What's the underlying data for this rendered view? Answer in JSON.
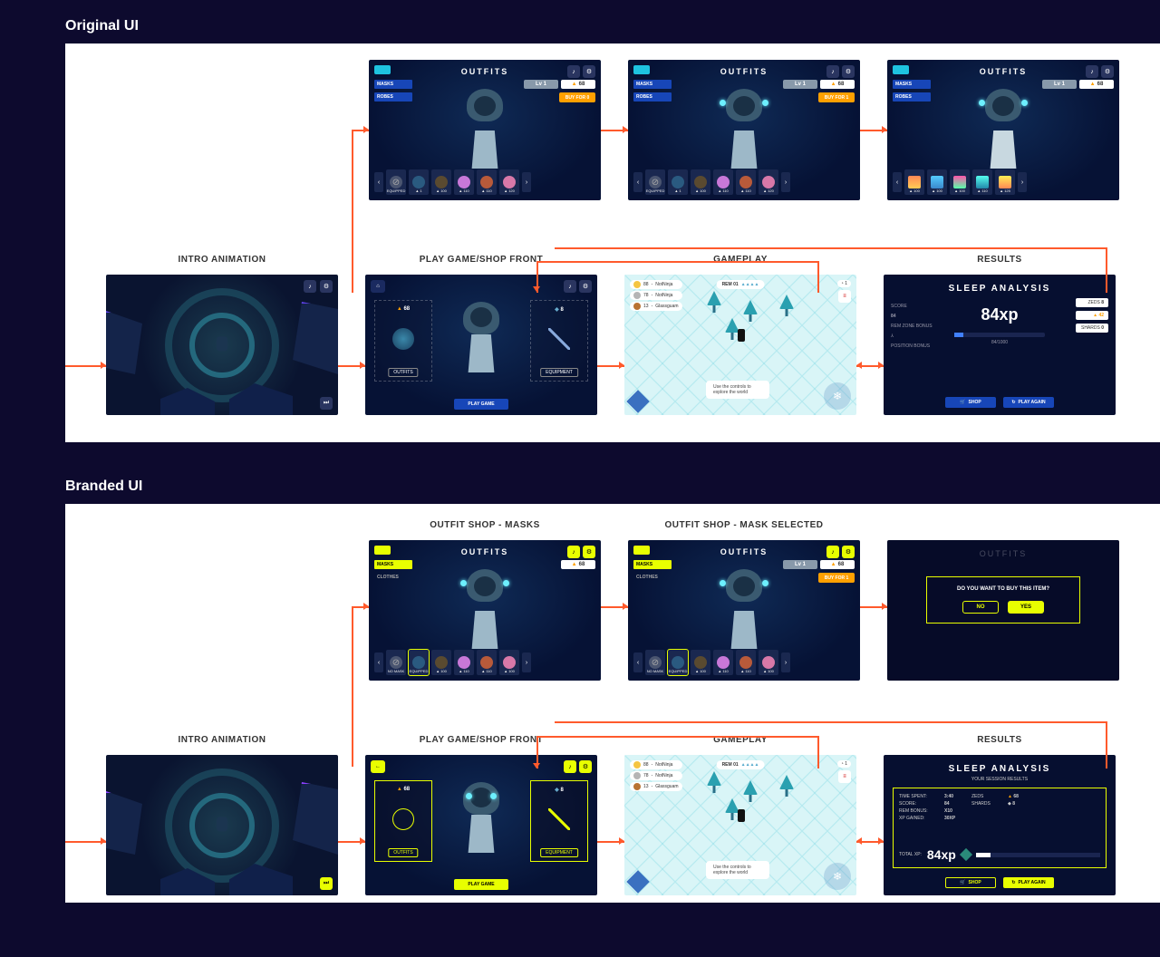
{
  "sections": {
    "original": {
      "title": "Original UI"
    },
    "branded": {
      "title": "Branded UI"
    }
  },
  "stage_labels": {
    "intro": "INTRO ANIMATION",
    "shopfront": "PLAY GAME/SHOP FRONT",
    "gameplay": "GAMEPLAY",
    "results": "RESULTS",
    "shop_masks": "OUTFIT SHOP - MASKS",
    "shop_mask_selected": "OUTFIT SHOP - MASK SELECTED"
  },
  "colors": {
    "accent_original": "#1746b8",
    "accent_branded": "#e8ff00",
    "flow": "#ff5a2c",
    "bg_page": "#0d0a2e"
  },
  "outfits_screen": {
    "title": "OUTFITS",
    "back_icon": "arrow-left",
    "top_buttons": [
      "sound-icon",
      "settings-icon"
    ],
    "tabs_original": [
      "MASKS",
      "ROBES"
    ],
    "tabs_branded": [
      "MASKS",
      "CLOTHES"
    ],
    "currency_chip": {
      "icon": "triangle",
      "value": 68
    },
    "level_chip": "Lv 1",
    "buy_button": "BUY FOR 1",
    "buy_button_none": "BUY FOR 0",
    "no_mask_label": "NO MASK",
    "equipped_label": "EQUIPPED",
    "mask_prices": [
      1,
      100,
      110,
      110,
      120
    ],
    "mask_prices_branded": [
      1,
      100,
      110,
      110,
      100
    ],
    "robe_prices": [
      100,
      100,
      100,
      110,
      125
    ]
  },
  "shopfront_screen": {
    "home_icon": "home",
    "top_buttons": [
      "sound-icon",
      "settings-icon"
    ],
    "left_panel": {
      "currency_icon": "triangle",
      "currency_value": 68,
      "label": "OUTFITS"
    },
    "right_panel": {
      "currency_icon": "diamond",
      "currency_value": 8,
      "label": "EQUIPMENT"
    },
    "play_button": "PLAY GAME"
  },
  "gameplay_screen": {
    "leaderboard": [
      {
        "rank": 88,
        "name": "NotNinja",
        "medal": "#f5c542"
      },
      {
        "rank": 78,
        "name": "NotNinja",
        "medal": "#b5b5b5"
      },
      {
        "rank": 13,
        "name": "Glassguam",
        "medal": "#b87333"
      }
    ],
    "rem_label": "REM 01",
    "rem_icons": 4,
    "tip": "Use the controls to explore the world",
    "ctrl_icon": "snowflake",
    "menu_icon": "menu"
  },
  "results_screen_original": {
    "title": "SLEEP ANALYSIS",
    "xp": "84xp",
    "progress_label": "84/1000",
    "left_stats": [
      {
        "label": "SCORE",
        "value": "84"
      },
      {
        "label": "REM ZONE BONUS",
        "value": ""
      },
      {
        "label": "POSITION BONUS",
        "value": ""
      }
    ],
    "right_stats": [
      {
        "label": "ZEDS",
        "value": 8
      },
      {
        "label": "",
        "value": 42
      },
      {
        "label": "SHARDS",
        "value": 0
      }
    ],
    "shop_button": "SHOP",
    "again_button": "PLAY AGAIN"
  },
  "results_screen_branded": {
    "title": "SLEEP ANALYSIS",
    "subtitle": "YOUR SESSION RESULTS",
    "rows_left": [
      {
        "label": "TIME SPENT:",
        "value": "3:40"
      },
      {
        "label": "SCORE:",
        "value": "84"
      },
      {
        "label": "REM BONUS:",
        "value": "X10"
      },
      {
        "label": "XP GAINED:",
        "value": "30XP"
      }
    ],
    "rows_right": [
      {
        "label": "ZEDS",
        "value": 68
      },
      {
        "label": "SHARDS",
        "value": 8
      }
    ],
    "total_label": "TOTAL XP:",
    "total_xp": "84xp",
    "shop_button": "SHOP",
    "again_button": "PLAY AGAIN"
  },
  "confirm_dialog": {
    "question": "DO YOU WANT TO BUY THIS ITEM?",
    "no": "NO",
    "yes": "YES"
  }
}
